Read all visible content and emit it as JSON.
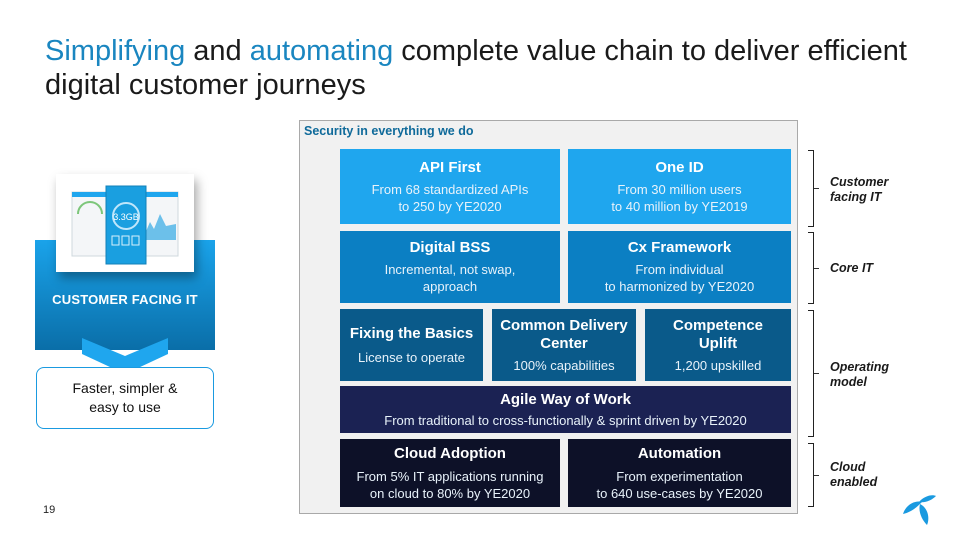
{
  "title": {
    "hl1": "Simplifying",
    "t1": " and ",
    "hl2": "automating",
    "t2": " complete value chain to deliver efficient digital customer journeys"
  },
  "panel": {
    "label": "Security in everything we do",
    "rows": [
      [
        {
          "heading": "API First",
          "sub": "From 68 standardized APIs\nto 250 by YE2020"
        },
        {
          "heading": "One ID",
          "sub": "From 30 million users\nto 40 million by YE2019"
        }
      ],
      [
        {
          "heading": "Digital BSS",
          "sub": "Incremental, not swap,\napproach"
        },
        {
          "heading": "Cx Framework",
          "sub": "From individual\nto harmonized by YE2020"
        }
      ],
      [
        {
          "heading": "Fixing the Basics",
          "sub": "License to operate"
        },
        {
          "heading": "Common Delivery\nCenter",
          "sub": "100% capabilities"
        },
        {
          "heading": "Competence\nUplift",
          "sub": "1,200 upskilled"
        }
      ],
      [
        {
          "heading": "Agile Way of Work",
          "sub": "From traditional to cross-functionally & sprint driven by YE2020"
        }
      ],
      [
        {
          "heading": "Cloud Adoption",
          "sub": "From 5% IT applications running\non cloud to 80% by YE2020"
        },
        {
          "heading": "Automation",
          "sub": "From experimentation\nto 640 use-cases by YE2020"
        }
      ]
    ]
  },
  "side_labels": [
    "Customer\nfacing IT",
    "Core IT",
    "Operating\nmodel",
    "Cloud\nenabled"
  ],
  "left": {
    "banner": "CUSTOMER FACING IT",
    "result": "Faster, simpler &\neasy to use",
    "app_readout": "3.3GB"
  },
  "page_number": "19",
  "colors": {
    "accent": "#1a86c0",
    "tier1": "#1fa6ee",
    "tier2": "#0b7fc3",
    "tier3": "#0a5a8a",
    "tier4": "#1b2253",
    "tier5": "#0d1128",
    "logo": "#1a9ae0"
  }
}
